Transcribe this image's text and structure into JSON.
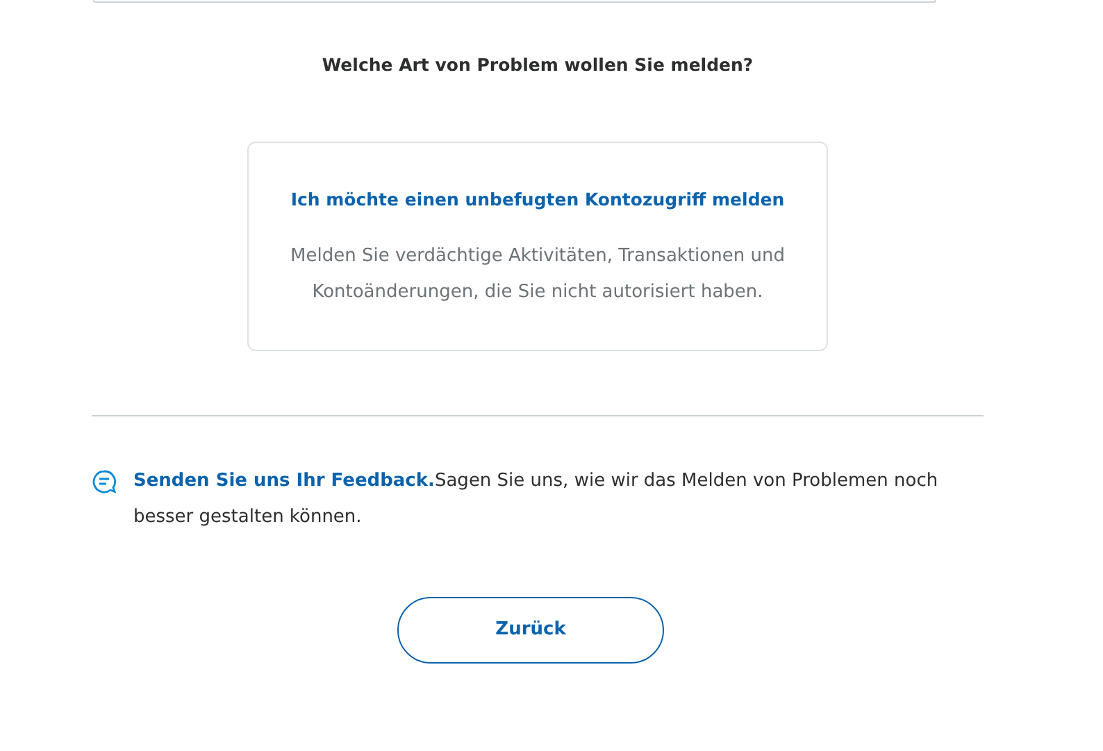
{
  "question": "Welche Art von Problem wollen Sie melden?",
  "options": [
    {
      "title": "Ich möchte einen unbefugten Kontozugriff melden",
      "description": "Melden Sie verdächtige Aktivitäten, Transaktionen und Kontoänderungen, die Sie nicht autorisiert haben."
    }
  ],
  "feedback": {
    "link": "Senden Sie uns Ihr Feedback.",
    "text": "Sagen Sie uns, wie wir das Melden von Problemen noch besser gestalten können."
  },
  "buttons": [
    "Zurück"
  ]
}
